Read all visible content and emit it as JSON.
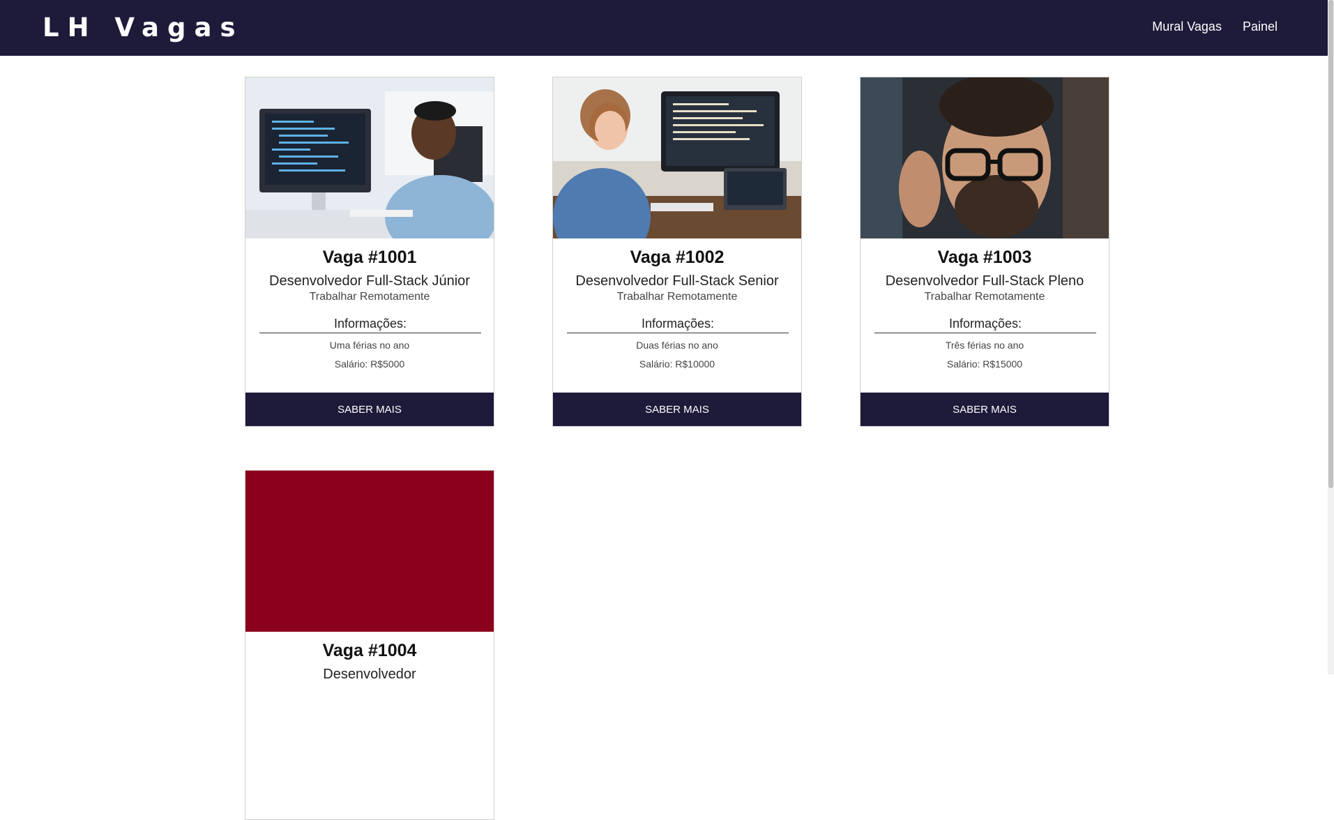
{
  "navbar": {
    "brand": "LH Vagas",
    "links": [
      "Mural Vagas",
      "Painel"
    ]
  },
  "jobs": [
    {
      "title": "Vaga #1001",
      "role": "Desenvolvedor Full-Stack Júnior",
      "mode": "Trabalhar Remotamente",
      "info_heading": "Informações:",
      "vacation": "Uma férias no ano",
      "salary": "Salário: R$5000",
      "button": "SABER MAIS"
    },
    {
      "title": "Vaga #1002",
      "role": "Desenvolvedor Full-Stack Senior",
      "mode": "Trabalhar Remotamente",
      "info_heading": "Informações:",
      "vacation": "Duas férias no ano",
      "salary": "Salário: R$10000",
      "button": "SABER MAIS"
    },
    {
      "title": "Vaga #1003",
      "role": "Desenvolvedor Full-Stack Pleno",
      "mode": "Trabalhar Remotamente",
      "info_heading": "Informações:",
      "vacation": "Três férias no ano",
      "salary": "Salário: R$15000",
      "button": "SABER MAIS"
    },
    {
      "title": "Vaga #1004",
      "role": "Desenvolvedor",
      "image_color": "#8b001c"
    }
  ],
  "colors": {
    "navbar": "#1e1a3a",
    "button": "#1e1a3a",
    "placeholder_image": "#8b001c"
  }
}
